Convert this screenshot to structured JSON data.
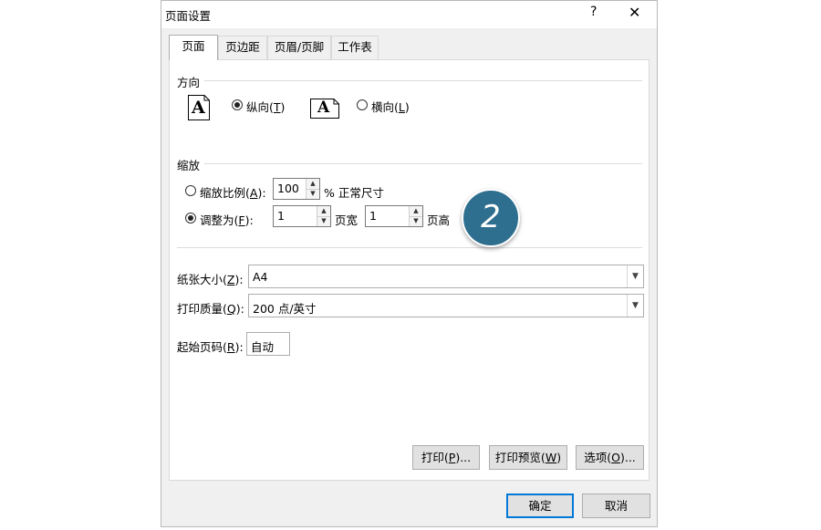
{
  "window": {
    "title": "页面设置",
    "help": "?",
    "close": "✕"
  },
  "tabs": [
    {
      "label": "页面",
      "active": true
    },
    {
      "label": "页边距"
    },
    {
      "label": "页眉/页脚"
    },
    {
      "label": "工作表"
    }
  ],
  "orientation": {
    "heading": "方向",
    "icon_letter": "A",
    "portrait": {
      "label": "纵向(",
      "key": "T",
      "suffix": ")",
      "selected": true
    },
    "landscape": {
      "label": "横向(",
      "key": "L",
      "suffix": ")",
      "selected": false
    }
  },
  "scaling": {
    "heading": "缩放",
    "adjust": {
      "label": "缩放比例(",
      "key": "A",
      "suffix": "):",
      "value": "100",
      "unit": "% 正常尺寸",
      "selected": false
    },
    "fit": {
      "label": "调整为(",
      "key": "F",
      "suffix": "):",
      "wide_value": "1",
      "wide_unit": "页宽",
      "tall_value": "1",
      "tall_unit": "页高",
      "selected": true
    }
  },
  "paper_size": {
    "label": "纸张大小(",
    "key": "Z",
    "suffix": "):",
    "value": "A4"
  },
  "print_quality": {
    "label": "打印质量(",
    "key": "Q",
    "suffix": "):",
    "value": "200 点/英寸"
  },
  "first_page": {
    "label": "起始页码(",
    "key": "R",
    "suffix": "):",
    "value": "自动"
  },
  "buttons": {
    "print": {
      "label": "打印(",
      "key": "P",
      "suffix": ")..."
    },
    "preview": {
      "label": "打印预览(",
      "key": "W",
      "suffix": ")"
    },
    "options": {
      "label": "选项(",
      "key": "O",
      "suffix": ")..."
    },
    "ok": "确定",
    "cancel": "取消"
  },
  "step_badge": "2",
  "colors": {
    "badge": "#2e6e8e",
    "focus": "#0078d7"
  }
}
